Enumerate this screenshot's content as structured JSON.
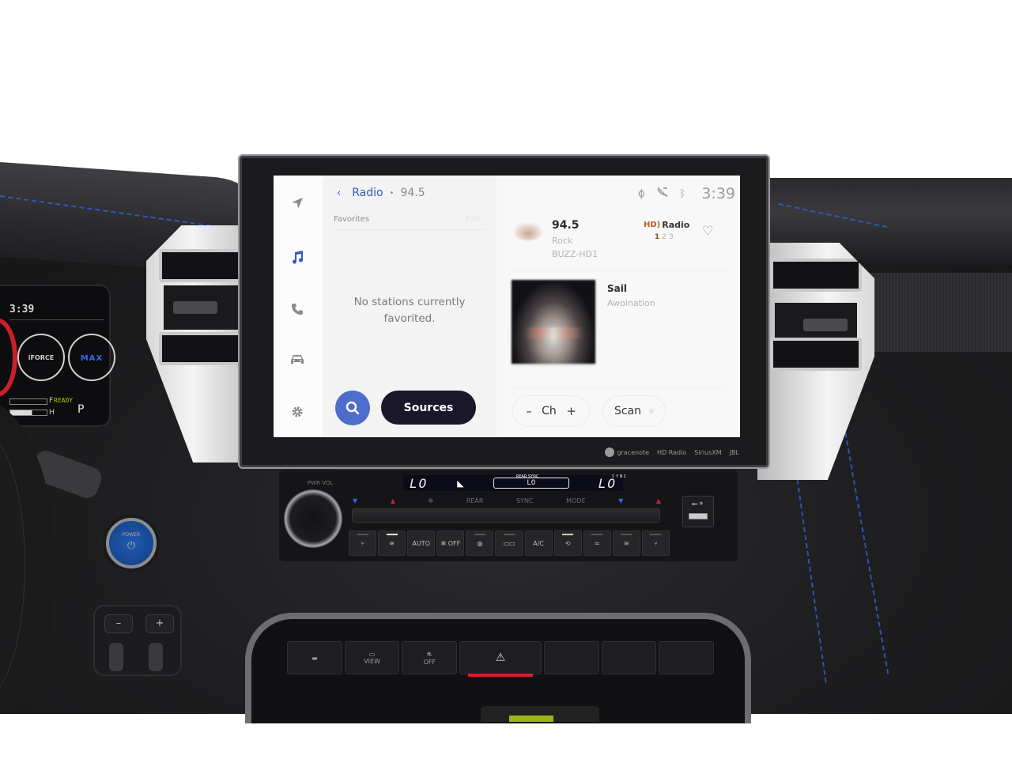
{
  "infotainment": {
    "nav_rail": [
      {
        "name": "navigation",
        "icon": "navigation-arrow-icon",
        "glyph": "➤",
        "active": false
      },
      {
        "name": "media",
        "icon": "music-note-icon",
        "glyph": "♫",
        "active": true
      },
      {
        "name": "phone",
        "icon": "phone-icon",
        "glyph": "✆",
        "active": false
      },
      {
        "name": "vehicle",
        "icon": "car-icon",
        "glyph": "🚘",
        "active": false
      },
      {
        "name": "settings",
        "icon": "gear-icon",
        "glyph": "⚙",
        "active": false
      }
    ],
    "header": {
      "back_glyph": "‹",
      "title": "Radio",
      "separator": "•",
      "subtitle": "94.5"
    },
    "favorites": {
      "label": "Favorites",
      "edit_label": "Edit",
      "empty_message_line1": "No stations currently",
      "empty_message_line2": "favorited."
    },
    "search_button": {
      "icon": "search-icon"
    },
    "sources_button": {
      "label": "Sources"
    },
    "status_bar": {
      "icons": [
        "wireless-charging-icon",
        "no-signal-satellite-icon",
        "bluetooth-icon"
      ],
      "glyphs": [
        "ϕ",
        "⚡",
        "ᛒ"
      ],
      "time": "3:39"
    },
    "now_playing": {
      "frequency": "94.5",
      "genre": "Rock",
      "call_sign": "BUZZ-HD1",
      "hd_logo_mark": "HD)",
      "hd_logo_text": "Radio",
      "hd_channels": [
        "1",
        "2",
        "3"
      ],
      "hd_active_channel": "1",
      "favorite_glyph": "♡",
      "song_title": "Sail",
      "artist": "Awolnation"
    },
    "controls": {
      "ch_minus": "–",
      "ch_label": "Ch",
      "ch_plus": "+",
      "scan_label": "Scan"
    },
    "brand_strip": [
      "gracenote",
      "HD Radio",
      "SiriusXM",
      "JBL"
    ]
  },
  "cluster": {
    "time": "3:39",
    "gauge_left_label": "iFORCE",
    "gauge_right_label": "MAX",
    "ready_label": "READY",
    "gear": "P",
    "fuel_label": "F",
    "temp_label": "H"
  },
  "power_button": {
    "label": "POWER",
    "glyph": "⏻"
  },
  "mirror_pad": {
    "minus": "–",
    "plus": "+"
  },
  "climate": {
    "knob_label": "PWR VOL",
    "left_temp": "LO",
    "right_temp": "LO",
    "rear_label": "REAR SYNC",
    "rear_temp": "LO",
    "sync_indicator": "SYNC",
    "rocker_labels": [
      "▼",
      "▲",
      "✻",
      "REAR",
      "SYNC",
      "MODE",
      "▼",
      "▲"
    ],
    "buttons": [
      {
        "label": "⑂",
        "icon": "heated-seat-left-icon",
        "led": "off"
      },
      {
        "label": "≋",
        "icon": "ventilated-seat-left-icon",
        "led": "on"
      },
      {
        "label": "AUTO",
        "icon": "",
        "led": "none"
      },
      {
        "label": "✻ OFF",
        "icon": "fan-off-icon",
        "led": "none"
      },
      {
        "label": "◍",
        "icon": "front-defrost-icon",
        "led": "off"
      },
      {
        "label": "▭▭",
        "icon": "rear-defrost-icon",
        "led": "off"
      },
      {
        "label": "A/C",
        "icon": "",
        "led": "none"
      },
      {
        "label": "⟲",
        "icon": "recirculation-icon",
        "led": "amber"
      },
      {
        "label": "≈",
        "icon": "air-flow-icon",
        "led": "off"
      },
      {
        "label": "≋",
        "icon": "ventilated-seat-right-icon",
        "led": "off"
      },
      {
        "label": "⑂",
        "icon": "heated-seat-right-icon",
        "led": "off"
      }
    ],
    "usb_glyph": "⭠⚬"
  },
  "console": {
    "buttons": [
      {
        "label": "▬",
        "icon": "trailer-icon"
      },
      {
        "label": "VIEW",
        "icon": "camera-view-icon"
      },
      {
        "label": "OFF",
        "icon": "traction-control-off-icon"
      },
      {
        "label": "⚠",
        "icon": "hazard-icon"
      },
      {
        "label": "",
        "icon": "blank-switch-icon"
      },
      {
        "label": "",
        "icon": "blank-switch-icon"
      },
      {
        "label": "",
        "icon": "blank-switch-icon"
      }
    ]
  }
}
